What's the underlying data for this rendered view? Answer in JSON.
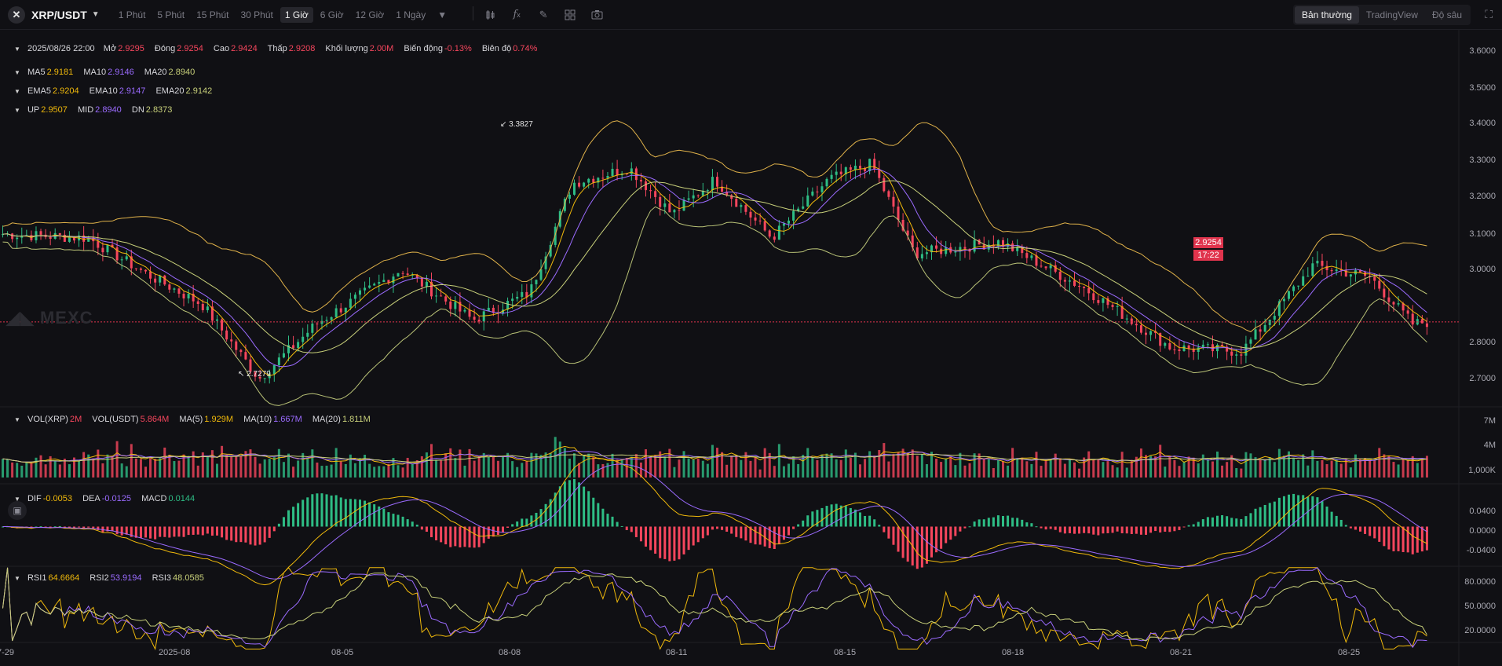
{
  "toolbar": {
    "symbol": "XRP/USDT",
    "intervals": [
      "1 Phút",
      "5 Phút",
      "15 Phút",
      "30 Phút",
      "1 Giờ",
      "6 Giờ",
      "12 Giờ",
      "1 Ngày"
    ],
    "active_interval": "1 Giờ",
    "tool_icons": [
      "candle-style-icon",
      "indicator-fx-icon",
      "draw-pencil-icon",
      "layout-grid-icon",
      "camera-icon"
    ],
    "views": [
      "Bản thường",
      "TradingView",
      "Độ sâu"
    ],
    "active_view": "Bản thường"
  },
  "ohlc": {
    "date": "2025/08/26 22:00",
    "open_label": "Mở",
    "open": "2.9295",
    "close_label": "Đóng",
    "close": "2.9254",
    "high_label": "Cao",
    "high": "2.9424",
    "low_label": "Thấp",
    "low": "2.9208",
    "volume_label": "Khối lượng",
    "volume": "2.00M",
    "change_label": "Biến động",
    "change": "-0.13%",
    "amplitude_label": "Biên độ",
    "amplitude": "0.74%"
  },
  "ma": {
    "ma5_label": "MA5",
    "ma5": "2.9181",
    "ma10_label": "MA10",
    "ma10": "2.9146",
    "ma20_label": "MA20",
    "ma20": "2.8940"
  },
  "ema": {
    "ema5_label": "EMA5",
    "ema5": "2.9204",
    "ema10_label": "EMA10",
    "ema10": "2.9147",
    "ema20_label": "EMA20",
    "ema20": "2.9142"
  },
  "boll": {
    "up_label": "UP",
    "up": "2.9507",
    "mid_label": "MID",
    "mid": "2.8940",
    "dn_label": "DN",
    "dn": "2.8373"
  },
  "volume_panel": {
    "vol_xrp_label": "VOL(XRP)",
    "vol_xrp": "2M",
    "vol_usdt_label": "VOL(USDT)",
    "vol_usdt": "5.864M",
    "ma5_label": "MA(5)",
    "ma5": "1.929M",
    "ma10_label": "MA(10)",
    "ma10": "1.667M",
    "ma20_label": "MA(20)",
    "ma20": "1.811M",
    "axis": [
      "7M",
      "4M",
      "1,000K"
    ]
  },
  "macd_panel": {
    "dif_label": "DIF",
    "dif": "-0.0053",
    "dea_label": "DEA",
    "dea": "-0.0125",
    "macd_label": "MACD",
    "macd": "0.0144",
    "axis": [
      "0.0400",
      "0.0000",
      "-0.0400"
    ]
  },
  "rsi_panel": {
    "rsi1_label": "RSI1",
    "rsi1": "64.6664",
    "rsi2_label": "RSI2",
    "rsi2": "53.9194",
    "rsi3_label": "RSI3",
    "rsi3": "48.0585",
    "axis": [
      "80.0000",
      "50.0000",
      "20.0000"
    ]
  },
  "price_axis": [
    "3.6000",
    "3.5000",
    "3.4000",
    "3.3000",
    "3.2000",
    "3.1000",
    "3.0000",
    "2.8000",
    "2.7000"
  ],
  "current_price": "2.9254",
  "countdown": "17:22",
  "high_marker": "3.3827",
  "low_marker": "2.7279",
  "watermark": "MEXC",
  "time_axis": [
    "7-29",
    "2025-08",
    "08-05",
    "08-08",
    "08-11",
    "08-15",
    "08-18",
    "08-21",
    "08-25"
  ],
  "colors": {
    "up": "#2ebd85",
    "down": "#f6465d",
    "ma5": "#f0b90b",
    "ma10": "#9b6bff",
    "ma20": "#c8d07a",
    "bg": "#101014"
  },
  "chart_data": {
    "type": "candlestick",
    "price_keypoints": [
      [
        0,
        3.15
      ],
      [
        6,
        3.14
      ],
      [
        10,
        3.05
      ],
      [
        14,
        2.97
      ],
      [
        18,
        2.78
      ],
      [
        22,
        2.92
      ],
      [
        28,
        3.06
      ],
      [
        33,
        2.93
      ],
      [
        37,
        3.0
      ],
      [
        40,
        3.28
      ],
      [
        44,
        3.32
      ],
      [
        47,
        3.2
      ],
      [
        50,
        3.29
      ],
      [
        54,
        3.14
      ],
      [
        58,
        3.29
      ],
      [
        61,
        3.33
      ],
      [
        64,
        3.1
      ],
      [
        70,
        3.13
      ],
      [
        76,
        3.01
      ],
      [
        82,
        2.86
      ],
      [
        87,
        2.85
      ],
      [
        92,
        3.07
      ],
      [
        96,
        3.04
      ],
      [
        99,
        2.92
      ],
      [
        100,
        2.925
      ]
    ],
    "y_range": [
      2.68,
      3.62
    ],
    "highest": 3.3827,
    "lowest": 2.7279
  }
}
